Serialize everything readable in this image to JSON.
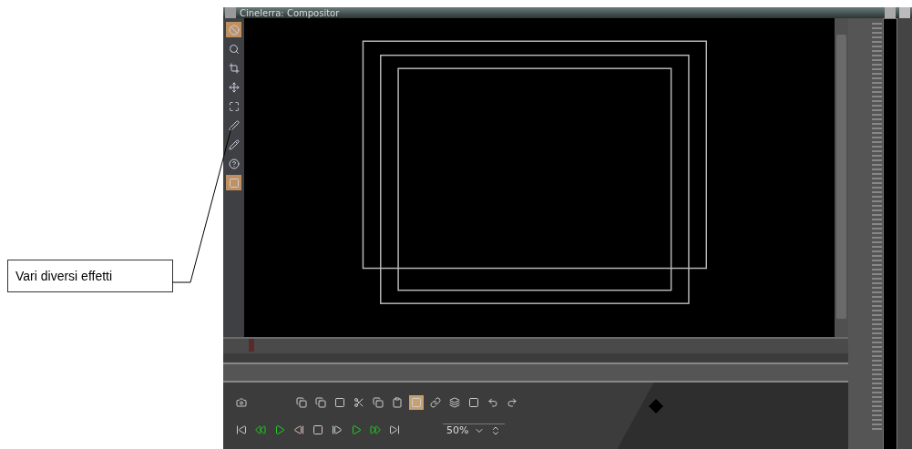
{
  "annotation": {
    "text": "Vari diversi effetti"
  },
  "window": {
    "title": "Cinelerra: Compositor"
  },
  "tools": [
    {
      "active": true
    },
    {
      "active": false
    },
    {
      "active": false
    },
    {
      "active": false
    },
    {
      "active": false
    },
    {
      "active": false
    },
    {
      "active": false
    },
    {
      "active": false
    },
    {
      "active": true
    }
  ],
  "edit_buttons": [
    {
      "active": false
    },
    {
      "active": false
    },
    {
      "active": false
    },
    {
      "active": false
    },
    {
      "active": false
    },
    {
      "active": false
    },
    {
      "active": true
    },
    {
      "active": false
    },
    {
      "active": false
    },
    {
      "active": false
    },
    {
      "active": false
    },
    {
      "active": false
    }
  ],
  "zoom": {
    "value": "50%"
  }
}
